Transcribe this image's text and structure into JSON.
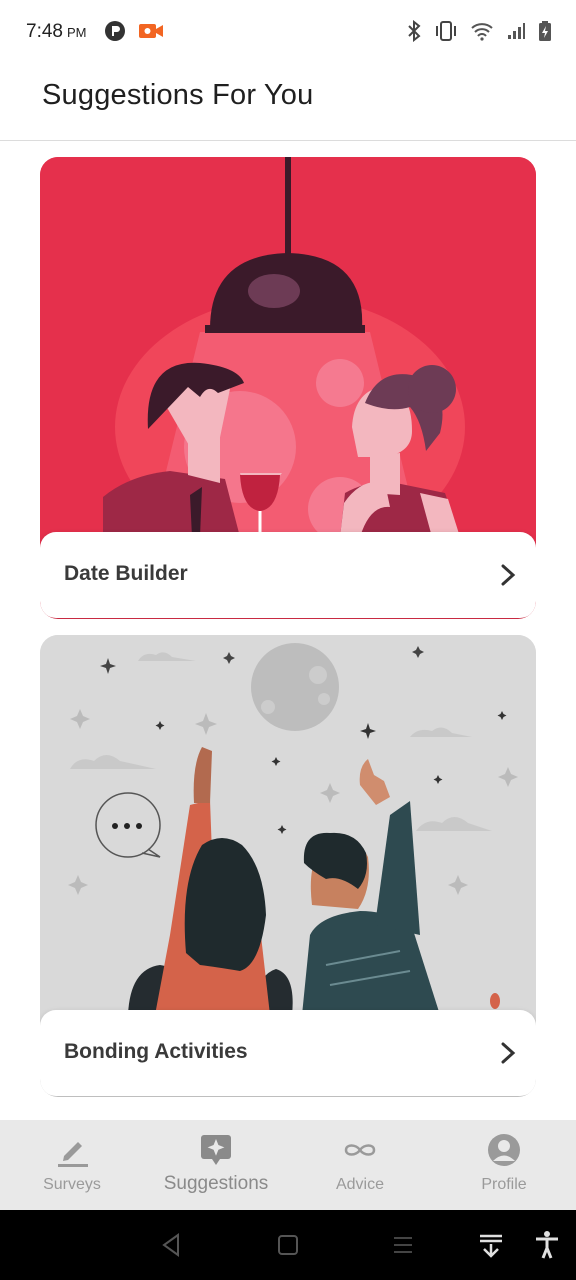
{
  "status_bar": {
    "time": "7:48",
    "ampm": "PM",
    "icons": [
      "app-p-icon",
      "video-record-icon",
      "bluetooth-icon",
      "vibrate-icon",
      "wifi-icon",
      "signal-icon",
      "battery-charging-icon"
    ]
  },
  "header": {
    "title": "Suggestions For You"
  },
  "cards": [
    {
      "label": "Date Builder",
      "illustration": "couple-dinner-under-lamp"
    },
    {
      "label": "Bonding Activities",
      "illustration": "couple-stargazing"
    }
  ],
  "bottom_nav": {
    "items": [
      {
        "label": "Surveys",
        "icon": "pencil-icon"
      },
      {
        "label": "Suggestions",
        "icon": "sparkle-icon"
      },
      {
        "label": "Advice",
        "icon": "infinity-icon"
      },
      {
        "label": "Profile",
        "icon": "profile-icon"
      }
    ],
    "active": "Suggestions"
  },
  "colors": {
    "card1_bg": "#e5304c",
    "card2_bg": "#d9d9d9",
    "nav_bg": "#e9e9e9",
    "text_dark": "#3a3a3a"
  }
}
